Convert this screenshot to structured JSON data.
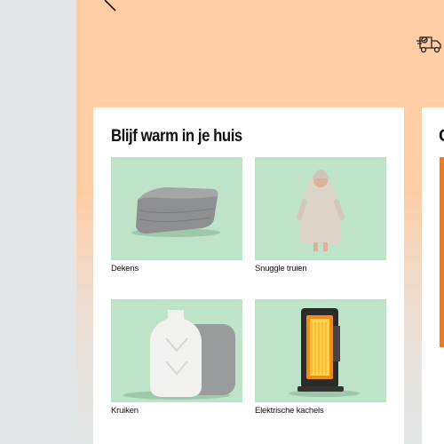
{
  "card": {
    "title": "Blijf warm in je huis",
    "tiles": [
      {
        "label": "Dekens",
        "icon": "blanket-image"
      },
      {
        "label": "Snuggle truien",
        "icon": "hoodie-blanket-image"
      },
      {
        "label": "Kruiken",
        "icon": "hot-water-bottle-image"
      },
      {
        "label": "Elektrische kachels",
        "icon": "electric-heater-image"
      }
    ]
  },
  "card2": {
    "title_fragment": "C"
  },
  "colors": {
    "hero": "#ffcca3",
    "tile_bg": "#bfe3c9",
    "accent_orange": "#f07a20"
  }
}
